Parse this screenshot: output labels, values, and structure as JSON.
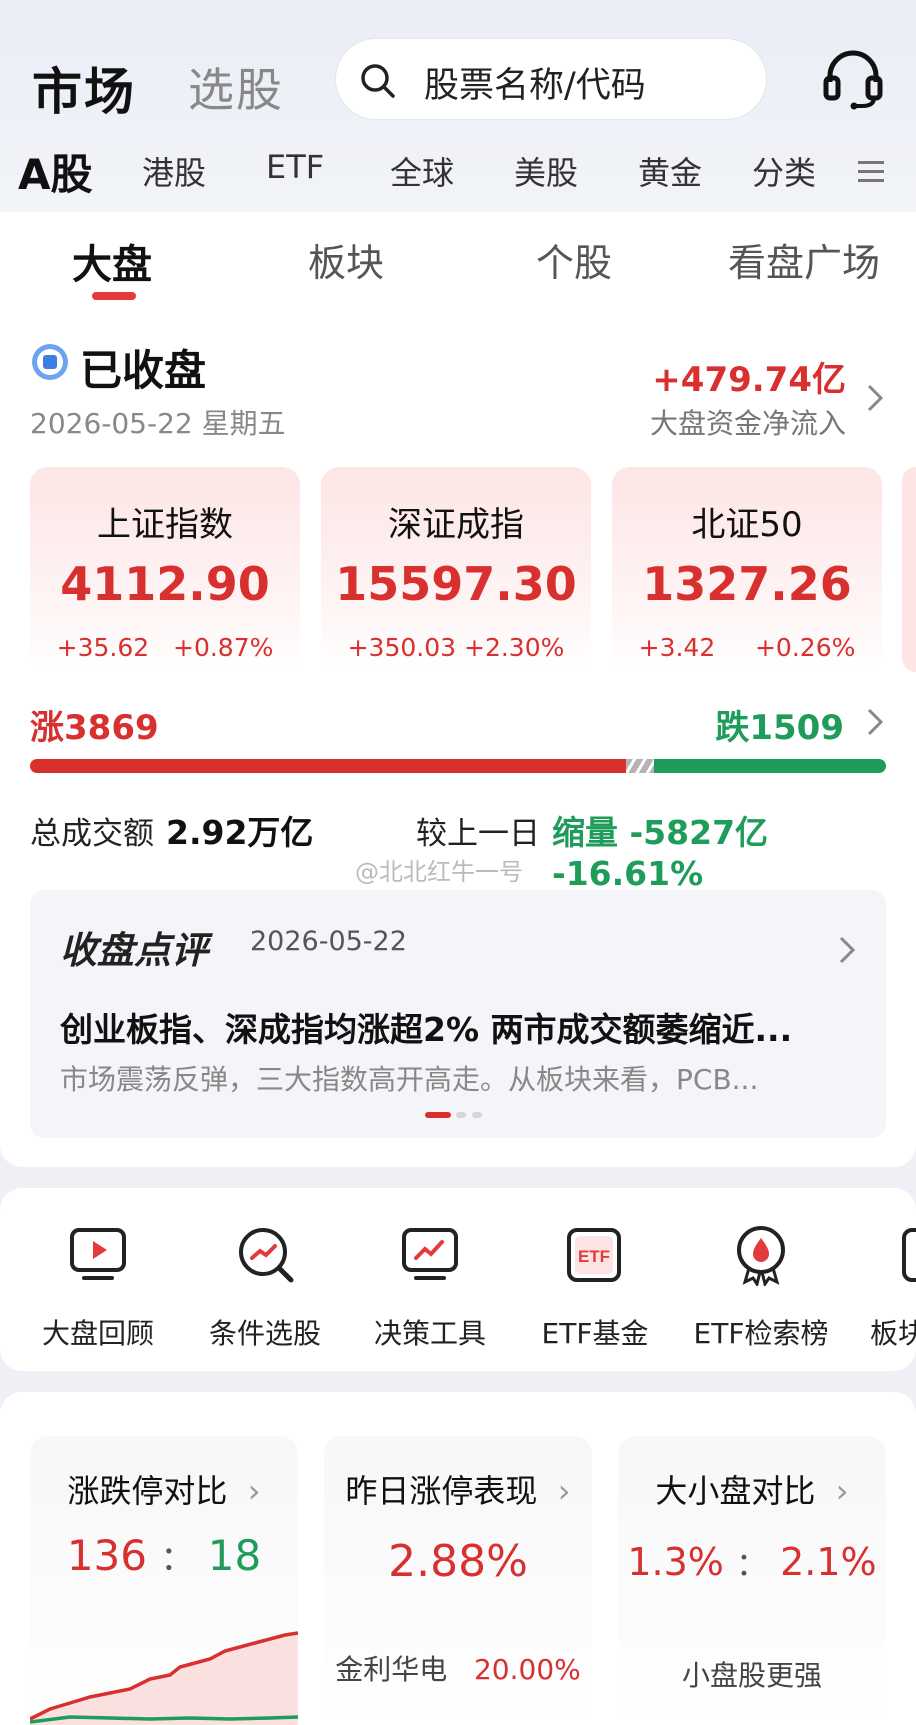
{
  "header": {
    "tab_market": "市场",
    "tab_pick": "选股",
    "search_placeholder": "股票名称/代码"
  },
  "market_tabs": [
    "A股",
    "港股",
    "ETF",
    "全球",
    "美股",
    "黄金",
    "分类"
  ],
  "sub_tabs": [
    "大盘",
    "板块",
    "个股",
    "看盘广场"
  ],
  "status": {
    "label": "已收盘",
    "date": "2026-05-22 星期五",
    "flow_value": "+479.74亿",
    "flow_label": "大盘资金净流入"
  },
  "indices": [
    {
      "name": "上证指数",
      "value": "4112.90",
      "change": "+35.62",
      "pct": "+0.87%"
    },
    {
      "name": "深证成指",
      "value": "15597.30",
      "change": "+350.03",
      "pct": "+2.30%"
    },
    {
      "name": "北证50",
      "value": "1327.26",
      "change": "+3.42",
      "pct": "+0.26%"
    }
  ],
  "breadth": {
    "up_label": "涨3869",
    "down_label": "跌1509",
    "up": 3869,
    "down": 1509
  },
  "volume": {
    "label": "总成交额",
    "value": "2.92万亿",
    "compare_label": "较上一日",
    "compare_value": "缩量 -5827亿  -16.61%"
  },
  "watermark": "@北北红牛一号",
  "review": {
    "title": "收盘点评",
    "date": "2026-05-22",
    "headline": "创业板指、深成指均涨超2% 两市成交额萎缩近...",
    "summary": "市场震荡反弹，三大指数高开高走。从板块来看，PCB..."
  },
  "tools": [
    {
      "label": "大盘回顾",
      "icon": "play-screen-icon"
    },
    {
      "label": "条件选股",
      "icon": "search-trend-icon"
    },
    {
      "label": "决策工具",
      "icon": "chart-monitor-icon"
    },
    {
      "label": "ETF基金",
      "icon": "etf-icon"
    },
    {
      "label": "ETF检索榜",
      "icon": "medal-icon"
    },
    {
      "label": "板块",
      "icon": "board-icon"
    }
  ],
  "stats": [
    {
      "title": "涨跌停对比",
      "big": "136 : 18",
      "limit_up": "136",
      "sep": "：",
      "limit_down": "18"
    },
    {
      "title": "昨日涨停表现",
      "big": "2.88%",
      "foot_name": "金利华电",
      "foot_value": "20.00%"
    },
    {
      "title": "大小盘对比",
      "small_cap": "1.3%",
      "sep": "：",
      "large_cap": "2.1%",
      "foot": "小盘股更强"
    }
  ],
  "colors": {
    "up": "#d8302f",
    "down": "#1e9c5a",
    "neutral": "#b4b4b4"
  }
}
